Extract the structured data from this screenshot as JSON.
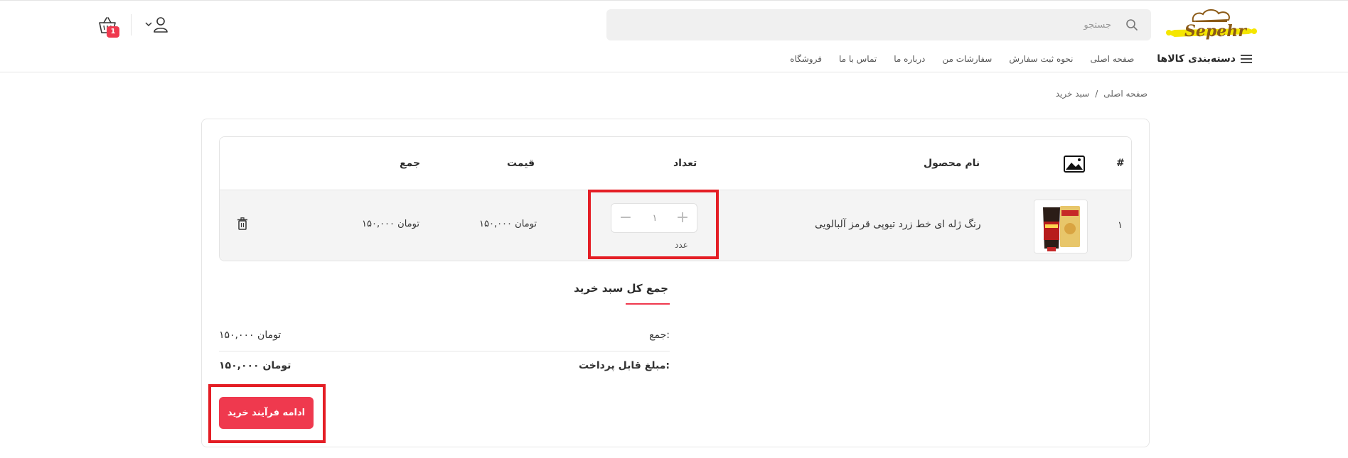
{
  "header": {
    "logo_text": "Sepehr",
    "search": {
      "placeholder": "جستجو",
      "value": ""
    },
    "cart_count": "1",
    "categories_label": "دسته‌بندی کالاها",
    "nav_items": [
      "صفحه اصلی",
      "نحوه ثبت سفارش",
      "سفارشات من",
      "درباره ما",
      "تماس با ما",
      "فروشگاه"
    ]
  },
  "breadcrumb": {
    "home": "صفحه اصلی",
    "sep": "/",
    "current": "سبد خرید"
  },
  "cart_table": {
    "headers": {
      "index": "#",
      "name": "نام محصول",
      "quantity": "تعداد",
      "price": "قیمت",
      "total": "جمع"
    },
    "rows": [
      {
        "index": "۱",
        "name": "رنگ ژله ای خط زرد تیوپی قرمز آلبالویی",
        "quantity": "۱",
        "unit": "عدد",
        "price": "۱۵۰,۰۰۰ تومان",
        "total": "۱۵۰,۰۰۰ تومان"
      }
    ]
  },
  "summary": {
    "title": "جمع کل سبد خرید",
    "subtotal_label": "جمع:",
    "subtotal_value": "۱۵۰,۰۰۰ تومان",
    "payable_label": "مبلغ قابل پرداخت:",
    "payable_value": "۱۵۰,۰۰۰ تومان",
    "checkout_button": "ادامه فرآیند خرید"
  },
  "colors": {
    "accent": "#ef394e",
    "highlight": "#e41e25",
    "logo_yellow": "#f5e600",
    "logo_brown": "#8b5a17"
  }
}
